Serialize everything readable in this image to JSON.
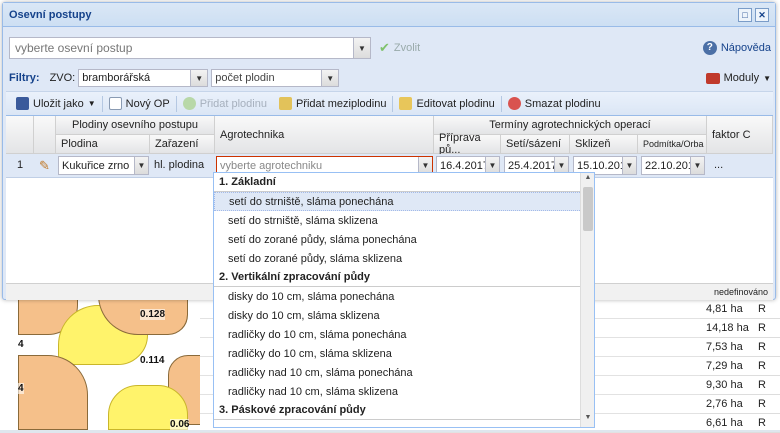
{
  "window": {
    "title": "Osevní postupy"
  },
  "top": {
    "select_placeholder": "vyberte osevní postup",
    "zvolit_label": "Zvolit",
    "napoveda_label": "Nápověda"
  },
  "filters": {
    "label": "Filtry:",
    "zvo_label": "ZVO:",
    "zvo_value": "bramborářská",
    "count_placeholder": "počet plodin",
    "moduly_label": "Moduly"
  },
  "toolbar": {
    "ulozit": "Uložit jako",
    "novy": "Nový OP",
    "pridat_plodinu": "Přidat plodinu",
    "pridat_mezi": "Přidat meziplodinu",
    "editovat": "Editovat plodinu",
    "smazat": "Smazat plodinu"
  },
  "grid": {
    "header_group1": "Plodiny osevního postupu",
    "col_plodina": "Plodina",
    "col_zarazeni": "Zařazení",
    "col_agro": "Agrotechnika",
    "header_group2": "Termíny agrotechnických operací",
    "col_priprava": "Příprava pů...",
    "col_seti": "Setí/sázení",
    "col_sklizen": "Sklizeň",
    "col_podmitka": "Podmítka/Orba",
    "col_faktor": "faktor C",
    "row": {
      "num": "1",
      "plodina": "Kukuřice zrno",
      "zarazeni": "hl. plodina",
      "agro_placeholder": "vyberte agrotechniku",
      "priprava": "16.4.2017",
      "seti": "25.4.2017",
      "sklizen": "15.10.2017",
      "podmitka": "22.10.2017",
      "faktor": "..."
    },
    "footer_text": "nedefinováno"
  },
  "dropdown": {
    "groups": [
      {
        "title": "1. Základní",
        "items": [
          "setí do strniště, sláma ponechána",
          "setí do strniště, sláma sklizena",
          "setí do zorané půdy, sláma ponechána",
          "setí do zorané půdy, sláma sklizena"
        ]
      },
      {
        "title": "2. Vertikální zpracování půdy",
        "items": [
          "disky do 10 cm, sláma ponechána",
          "disky do 10 cm, sláma sklizena",
          "radličky do 10 cm, sláma ponechána",
          "radličky do 10 cm, sláma sklizena",
          "radličky nad 10 cm, sláma ponechána",
          "radličky nad 10 cm, sláma sklizena"
        ]
      },
      {
        "title": "3. Páskové zpracování půdy",
        "items": []
      }
    ],
    "selected_index": 0
  },
  "background": {
    "map_labels": [
      "0.128",
      "0.114",
      "0.06",
      "4",
      "4"
    ],
    "rows": [
      {
        "area": "4,81 ha",
        "flag": "R"
      },
      {
        "area": "14,18 ha",
        "flag": "R"
      },
      {
        "area": "7,53 ha",
        "flag": "R"
      },
      {
        "area": "7,29 ha",
        "flag": "R"
      },
      {
        "area": "9,30 ha",
        "flag": "R"
      },
      {
        "area": "2,76 ha",
        "flag": "R"
      },
      {
        "area": "6,61 ha",
        "flag": "R"
      }
    ]
  },
  "colors": {
    "accent": "#15428b",
    "header_bg": "#dfe8f6",
    "selection": "#dfe8f6"
  }
}
